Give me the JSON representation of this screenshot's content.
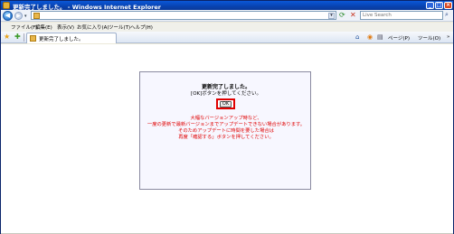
{
  "window": {
    "title": "更新完了しました。 - Windows Internet Explorer",
    "minimize": "_",
    "maximize": "□",
    "close": "×"
  },
  "address_bar": {
    "back": "◀",
    "forward": "▶",
    "dropdown": "▾",
    "url": "",
    "go_dropdown": "▾",
    "search_placeholder": "Live Search"
  },
  "menu": [
    "ファイル(F)",
    "編集(E)",
    "表示(V)",
    "お気に入り(A)",
    "ツール(T)",
    "ヘルプ(H)"
  ],
  "tabs": [
    {
      "label": "更新完了しました。"
    }
  ],
  "commands": {
    "home_icon": "home-icon",
    "feeds_icon": "feeds-icon",
    "print_icon": "print-icon",
    "page": "ページ(P)",
    "tools": "ツール(O)",
    "more": "»"
  },
  "dialog": {
    "title": "更新完了しました。",
    "instruction": "[OK]ボタンを押してください。",
    "ok_label": "OK",
    "notes": [
      "大幅なバージョンアップ時など、",
      "一度の更新で最新バージョンまでアップデートできない場合があります。",
      "そのためアップデートに時間を要した場合は",
      "再度「確認する」ボタンを押してください。"
    ]
  },
  "colors": {
    "titlebar": "#0a58d8",
    "note_text": "#e00000",
    "ok_highlight": "#e00000",
    "dialog_bg": "#f7f7ff"
  }
}
